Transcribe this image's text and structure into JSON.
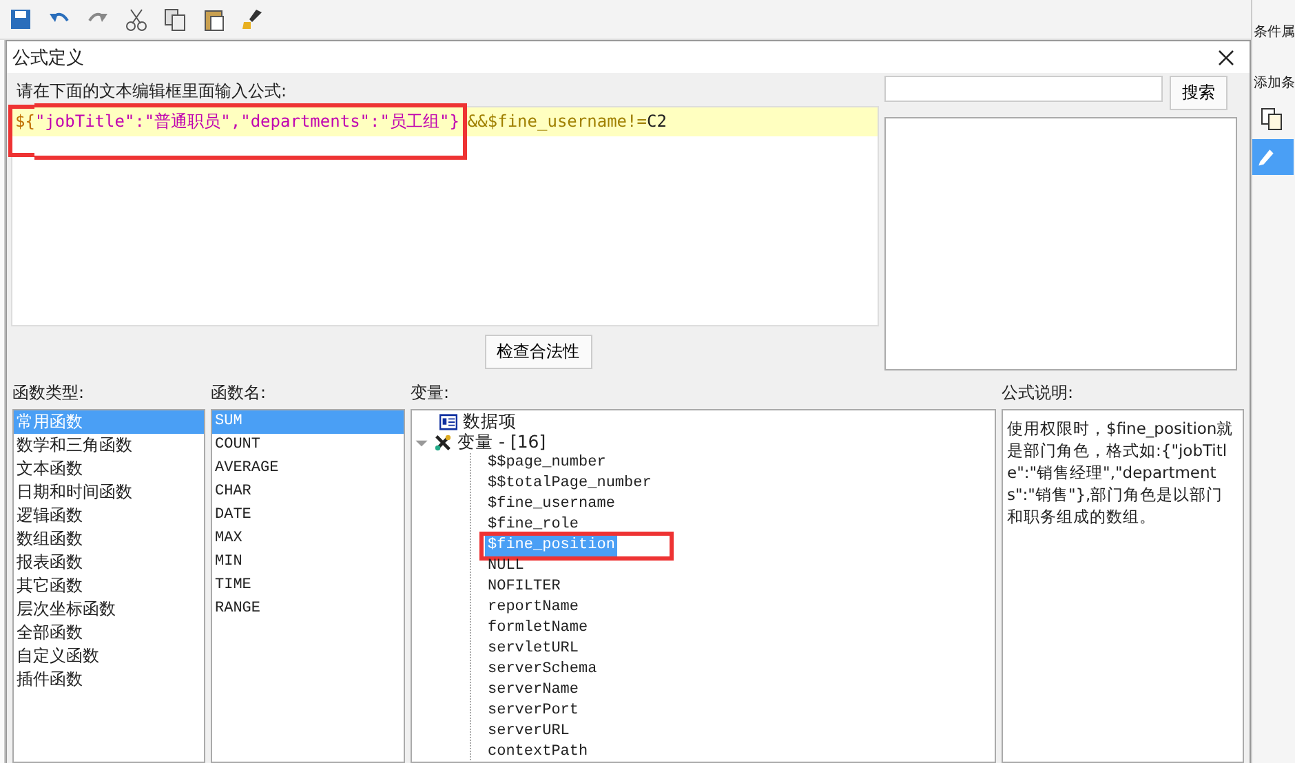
{
  "side_panel": {
    "title": "条件属",
    "add_label": "添加条"
  },
  "dialog": {
    "title": "公式定义",
    "editor": {
      "label": "请在下面的文本编辑框里面输入公式:",
      "tokens": [
        {
          "text": "${",
          "color": "#c07000",
          "annotated": true
        },
        {
          "text": "\"jobTitle\":\"普通职员\",\"departments\":\"员工组\"}",
          "color": "#c000b0",
          "annotated": true
        },
        {
          "text": "&&$fine_username!=",
          "color": "#a08000",
          "annotated": false
        },
        {
          "text": "C2",
          "color": "#202020",
          "annotated": false
        }
      ]
    },
    "search": {
      "button": "搜索"
    },
    "check_button": "检查合法性",
    "function_types": {
      "label": "函数类型:",
      "items": [
        {
          "label": "常用函数",
          "selected": true
        },
        {
          "label": "数学和三角函数",
          "selected": false
        },
        {
          "label": "文本函数",
          "selected": false
        },
        {
          "label": "日期和时间函数",
          "selected": false
        },
        {
          "label": "逻辑函数",
          "selected": false
        },
        {
          "label": "数组函数",
          "selected": false
        },
        {
          "label": "报表函数",
          "selected": false
        },
        {
          "label": "其它函数",
          "selected": false
        },
        {
          "label": "层次坐标函数",
          "selected": false
        },
        {
          "label": "全部函数",
          "selected": false
        },
        {
          "label": "自定义函数",
          "selected": false
        },
        {
          "label": "插件函数",
          "selected": false
        }
      ]
    },
    "function_names": {
      "label": "函数名:",
      "items": [
        {
          "label": "SUM",
          "selected": true
        },
        {
          "label": "COUNT",
          "selected": false
        },
        {
          "label": "AVERAGE",
          "selected": false
        },
        {
          "label": "CHAR",
          "selected": false
        },
        {
          "label": "DATE",
          "selected": false
        },
        {
          "label": "MAX",
          "selected": false
        },
        {
          "label": "MIN",
          "selected": false
        },
        {
          "label": "TIME",
          "selected": false
        },
        {
          "label": "RANGE",
          "selected": false
        }
      ]
    },
    "variables": {
      "label": "变量:",
      "tree": [
        {
          "label": "数据项",
          "kind": "data"
        },
        {
          "label": "变量 - [16]",
          "kind": "group",
          "expanded": true,
          "children": [
            {
              "label": "$$page_number",
              "selected": false
            },
            {
              "label": "$$totalPage_number",
              "selected": false
            },
            {
              "label": "$fine_username",
              "selected": false
            },
            {
              "label": "$fine_role",
              "selected": false
            },
            {
              "label": "$fine_position",
              "selected": true
            },
            {
              "label": "NULL",
              "selected": false
            },
            {
              "label": "NOFILTER",
              "selected": false
            },
            {
              "label": "reportName",
              "selected": false
            },
            {
              "label": "formletName",
              "selected": false
            },
            {
              "label": "servletURL",
              "selected": false
            },
            {
              "label": "serverSchema",
              "selected": false
            },
            {
              "label": "serverName",
              "selected": false
            },
            {
              "label": "serverPort",
              "selected": false
            },
            {
              "label": "serverURL",
              "selected": false
            },
            {
              "label": "contextPath",
              "selected": false
            }
          ]
        }
      ]
    },
    "description": {
      "label": "公式说明:",
      "text": "使用权限时，$fine_position就是部门角色，格式如:{\"jobTitle\":\"销售经理\",\"departments\":\"销售\"},部门角色是以部门和职务组成的数组。"
    }
  }
}
